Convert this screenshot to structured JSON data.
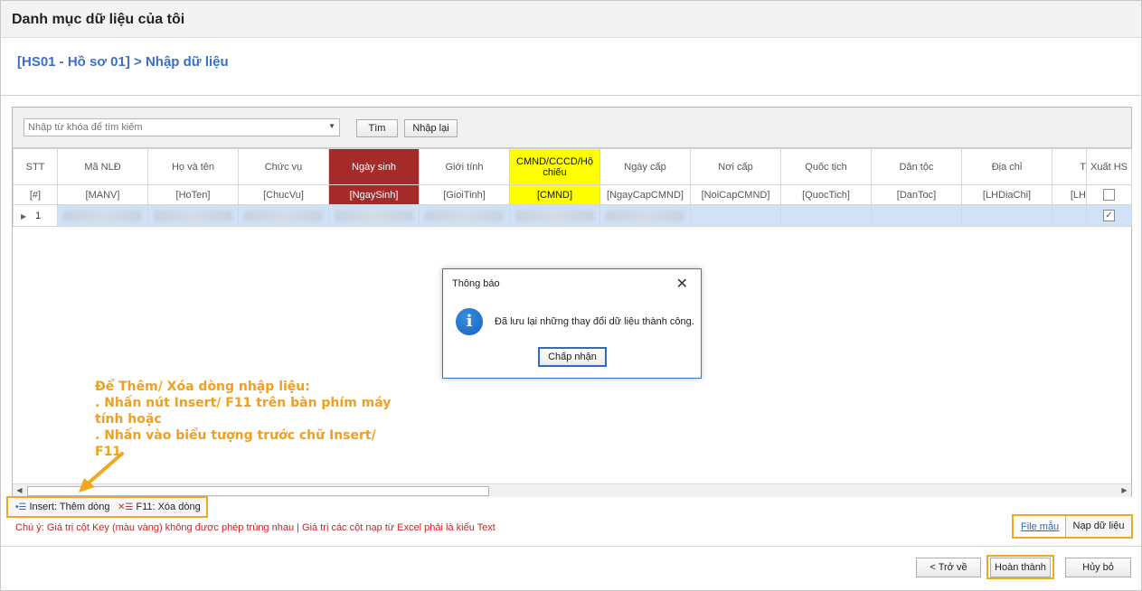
{
  "window": {
    "title": "Danh mục dữ liệu của tôi"
  },
  "breadcrumb": "[HS01 - Hồ sơ 01] > Nhập dữ liệu",
  "search": {
    "placeholder": "Nhập từ khóa để tìm kiếm",
    "value": ""
  },
  "toolbar": {
    "search_label": "Tìm",
    "reset_label": "Nhập lại"
  },
  "grid": {
    "columns": [
      "STT",
      "Mã NLĐ",
      "Họ và tên",
      "Chức vụ",
      "Ngày sinh",
      "Giới tính",
      "CMND/CCCD/Hộ chiếu",
      "Ngày cấp",
      "Nơi cấp",
      "Quốc tịch",
      "Dân tộc",
      "Địa chỉ",
      "T",
      "Xuất HS"
    ],
    "keys": [
      "[#]",
      "[MANV]",
      "[HoTen]",
      "[ChucVu]",
      "[NgaySinh]",
      "[GioiTinh]",
      "[CMND]",
      "[NgayCapCMND]",
      "[NoiCapCMND]",
      "[QuocTich]",
      "[DanToc]",
      "[LHDiaChi]",
      "[LH",
      ""
    ],
    "rows": [
      {
        "stt": "1",
        "export_checked": true
      }
    ]
  },
  "dialog": {
    "title": "Thông báo",
    "message": "Đã lưu lại những thay đổi dữ liệu thành công.",
    "ok_label": "Chấp nhận"
  },
  "annotation": {
    "line1": "Để Thêm/ Xóa dòng nhập liệu:",
    "line2": ". Nhấn nút Insert/ F11 trên bàn phím máy tính hoặc",
    "line3": ". Nhấn vào biểu tượng trước chữ Insert/ F11"
  },
  "shortcuts": {
    "insert_label": "Insert: Thêm dòng",
    "delete_label": "F11: Xóa dòng"
  },
  "note": "Chú ý: Giá trị cột Key (màu vàng) không được phép trùng nhau | Giá trị các cột nạp từ Excel phải là kiểu Text",
  "file_actions": {
    "template_label": "File mẫu",
    "load_label": "Nạp dữ liệu"
  },
  "footer": {
    "back_label": "< Trở về",
    "done_label": "Hoàn thành",
    "cancel_label": "Hủy bỏ"
  },
  "colors": {
    "key_column": "#ffff00",
    "required_column": "#a52a2a",
    "highlight": "#f0a820",
    "link": "#2a64c4"
  }
}
